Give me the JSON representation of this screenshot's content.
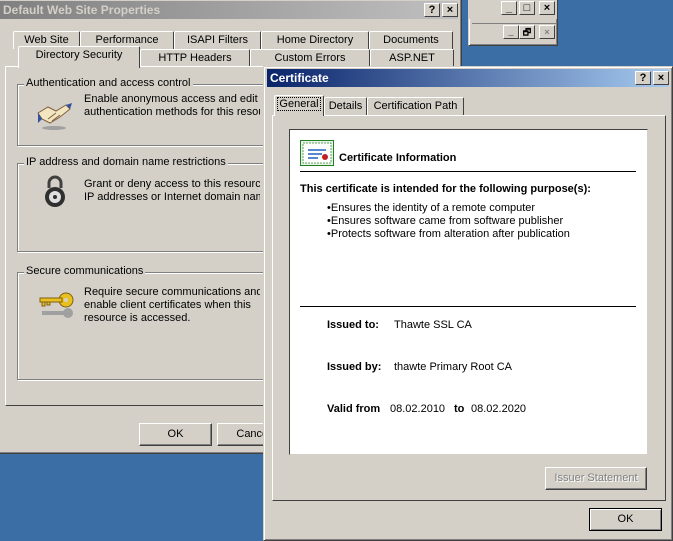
{
  "bg_window": {
    "title_buttons": [
      "_",
      "□",
      "×"
    ],
    "inner_buttons": [
      "_",
      "🗗",
      "×"
    ]
  },
  "props": {
    "title": "Default Web Site Properties",
    "help_glyph": "?",
    "close_glyph": "×",
    "tabs_row1": [
      "Web Site",
      "Performance",
      "ISAPI Filters",
      "Home Directory",
      "Documents"
    ],
    "tabs_row2": [
      "Directory Security",
      "HTTP Headers",
      "Custom Errors",
      "ASP.NET"
    ],
    "groups": {
      "auth": {
        "legend": "Authentication and access control",
        "line1": "Enable anonymous access and edit the",
        "line2": "authentication methods for this resource."
      },
      "ip": {
        "legend": "IP address and domain name restrictions",
        "line1": "Grant or deny access to this resource using",
        "line2": "IP addresses or Internet domain names."
      },
      "secure": {
        "legend": "Secure communications",
        "line1": "Require secure communications and",
        "line2": "enable client certificates when this",
        "line3": "resource is accessed."
      }
    },
    "ok_label": "OK",
    "cancel_label": "Cancel"
  },
  "cert": {
    "title": "Certificate",
    "help_glyph": "?",
    "close_glyph": "×",
    "tabs": [
      "General",
      "Details",
      "Certification Path"
    ],
    "info_heading": "Certificate Information",
    "purpose_heading": "This certificate is intended for the following purpose(s):",
    "purposes": [
      "•Ensures the identity of a remote computer",
      "•Ensures software came from software publisher",
      "•Protects software from alteration after publication"
    ],
    "issued_to_label": "Issued to:",
    "issued_to_value": "Thawte SSL CA",
    "issued_by_label": "Issued by:",
    "issued_by_value": "thawte Primary Root CA",
    "valid_from_label": "Valid from",
    "valid_from_value": "08.02.2010",
    "valid_to_label": "to",
    "valid_to_value": "08.02.2020",
    "issuer_statement_label": "Issuer Statement",
    "ok_label": "OK"
  }
}
